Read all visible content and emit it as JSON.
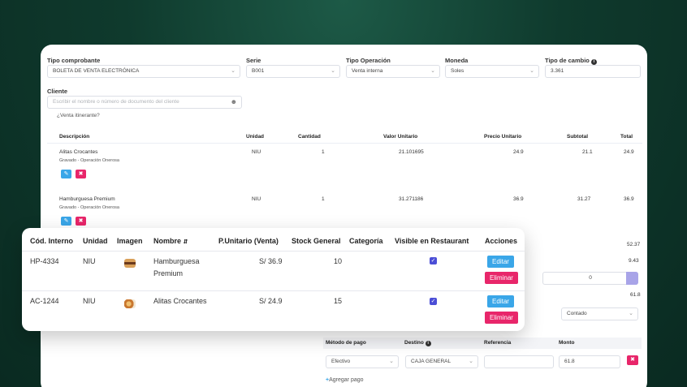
{
  "form": {
    "tipo_comprobante": {
      "label": "Tipo comprobante",
      "value": "BOLETA DE VENTA ELECTRÓNICA"
    },
    "serie": {
      "label": "Serie",
      "value": "B001"
    },
    "tipo_operacion": {
      "label": "Tipo Operación",
      "value": "Venta interna"
    },
    "moneda": {
      "label": "Moneda",
      "value": "Soles"
    },
    "tipo_cambio": {
      "label": "Tipo de cambio",
      "value": "3.361"
    },
    "cliente": {
      "label": "Cliente",
      "placeholder": "Escribir el nombre o número de documento del cliente"
    },
    "venta_itinerante": "¿Venta itinerante?"
  },
  "items_table": {
    "headers": [
      "Descripción",
      "Unidad",
      "Cantidad",
      "Valor Unitario",
      "Precio Unitario",
      "Subtotal",
      "Total"
    ],
    "rows": [
      {
        "descripcion": "Alitas Crocantes",
        "nota": "Gravado - Operación Onerosa",
        "unidad": "NIU",
        "cantidad": "1",
        "valor_unitario": "21.101695",
        "precio_unitario": "24.9",
        "subtotal": "21.1",
        "total": "24.9"
      },
      {
        "descripcion": "Hamburguesa Premium",
        "nota": "Gravado - Operación Onerosa",
        "unidad": "NIU",
        "cantidad": "1",
        "valor_unitario": "31.271186",
        "precio_unitario": "36.9",
        "subtotal": "31.27",
        "total": "36.9"
      }
    ]
  },
  "totals": {
    "v1": "52.37",
    "v2": "9.43",
    "input_value": "0",
    "v3": "61.8",
    "condicion": "Contado"
  },
  "payments": {
    "headers": [
      "Método de pago",
      "Destino",
      "Referencia",
      "Monto"
    ],
    "metodo": "Efectivo",
    "destino": "CAJA GENERAL",
    "referencia": "",
    "monto": "61.8",
    "agregar": "Agregar pago"
  },
  "products_overlay": {
    "headers": [
      "Cód. Interno",
      "Unidad",
      "Imagen",
      "Nombre",
      "P.Unitario (Venta)",
      "Stock General",
      "Categoría",
      "Visible en Restaurant",
      "Acciones"
    ],
    "sort_icon": "sort-icon",
    "edit_label": "Editar",
    "delete_label": "Eliminar",
    "rows": [
      {
        "codigo": "HP-4334",
        "unidad": "NIU",
        "nombre": "Hamburguesa Premium",
        "precio": "S/ 36.9",
        "stock": "10",
        "categoria": "",
        "visible": true
      },
      {
        "codigo": "AC-1244",
        "unidad": "NIU",
        "nombre": "Alitas Crocantes",
        "precio": "S/ 24.9",
        "stock": "15",
        "categoria": "",
        "visible": true
      }
    ]
  },
  "colors": {
    "blue": "#3aa6e8",
    "pink": "#e8266a",
    "check": "#4b4ed6",
    "background": "#0f3a2d"
  }
}
